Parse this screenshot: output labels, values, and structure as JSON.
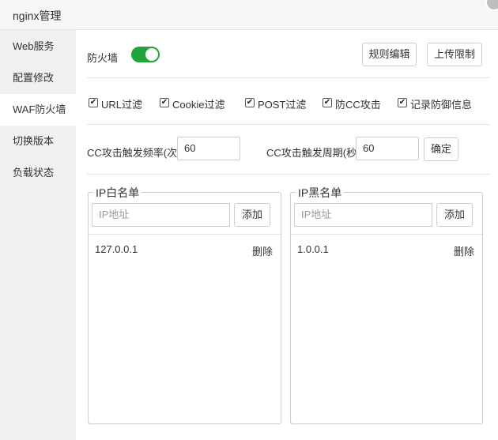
{
  "window": {
    "title": "nginx管理"
  },
  "sidebar": {
    "items": [
      {
        "label": "Web服务"
      },
      {
        "label": "配置修改"
      },
      {
        "label": "WAF防火墙"
      },
      {
        "label": "切换版本"
      },
      {
        "label": "负载状态"
      }
    ],
    "active_index": 2
  },
  "firewall": {
    "label": "防火墙",
    "enabled": true,
    "rule_edit_label": "规则编辑",
    "upload_limit_label": "上传限制"
  },
  "options": [
    {
      "label": "URL过滤",
      "checked": true
    },
    {
      "label": "Cookie过滤",
      "checked": true
    },
    {
      "label": "POST过滤",
      "checked": true
    },
    {
      "label": "防CC攻击",
      "checked": true
    },
    {
      "label": "记录防御信息",
      "checked": true
    }
  ],
  "cc": {
    "freq_label": "CC攻击触发频率(次)",
    "freq_value": "60",
    "period_label": "CC攻击触发周期(秒)",
    "period_value": "60",
    "confirm_label": "确定"
  },
  "whitelist": {
    "title": "IP白名单",
    "placeholder": "IP地址",
    "add_label": "添加",
    "rows": [
      {
        "ip": "127.0.0.1",
        "delete_label": "删除"
      }
    ]
  },
  "blacklist": {
    "title": "IP黑名单",
    "placeholder": "IP地址",
    "add_label": "添加",
    "rows": [
      {
        "ip": "1.0.0.1",
        "delete_label": "删除"
      }
    ]
  },
  "colors": {
    "accent": "#20a53a",
    "sidebar_bg": "#f0f0f0"
  }
}
